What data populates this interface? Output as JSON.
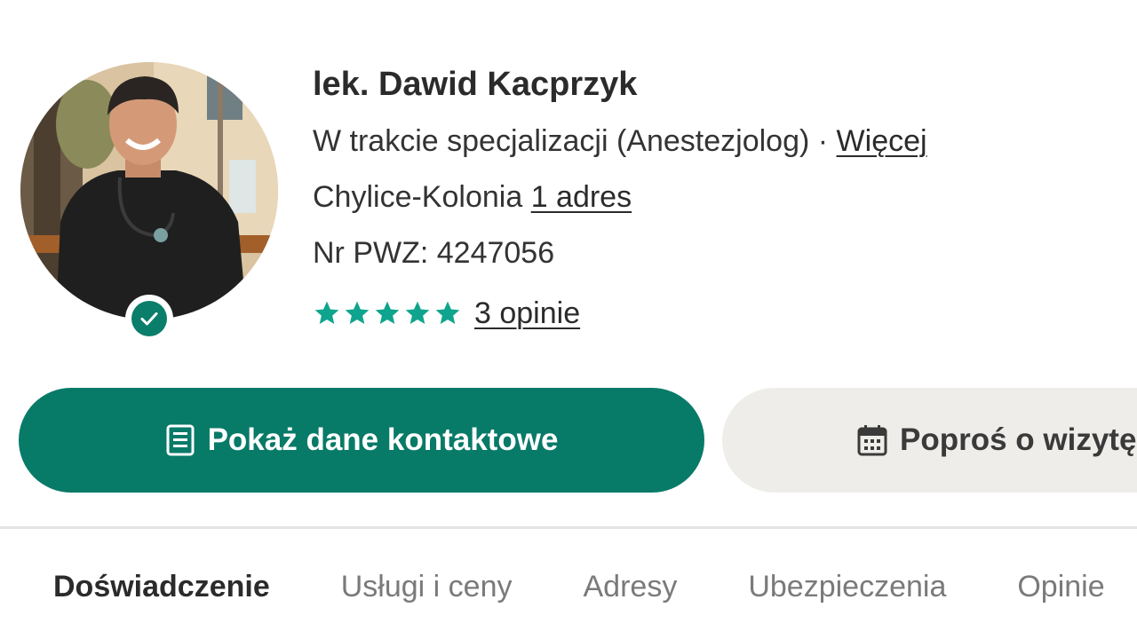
{
  "profile": {
    "name": "lek. Dawid Kacprzyk",
    "specialization": "W trakcie specjalizacji (Anestezjolog)",
    "separator": "·",
    "more_link": "Więcej",
    "location": "Chylice-Kolonia",
    "address_link": "1 adres",
    "pwz": "Nr PWZ: 4247056",
    "rating_stars": 5,
    "reviews_link": "3 opinie",
    "verified": true
  },
  "buttons": {
    "contact_label": "Pokaż dane kontaktowe",
    "visit_label": "Poproś o wizytę",
    "contact_icon": "contact-card-icon",
    "visit_icon": "calendar-icon"
  },
  "tabs": [
    {
      "label": "Doświadczenie",
      "active": true
    },
    {
      "label": "Usługi i ceny",
      "active": false
    },
    {
      "label": "Adresy",
      "active": false
    },
    {
      "label": "Ubezpieczenia",
      "active": false
    },
    {
      "label": "Opinie",
      "active": false
    }
  ],
  "colors": {
    "brand": "#087a68",
    "star": "#0fa48d",
    "secondary_button": "#eeedea"
  }
}
